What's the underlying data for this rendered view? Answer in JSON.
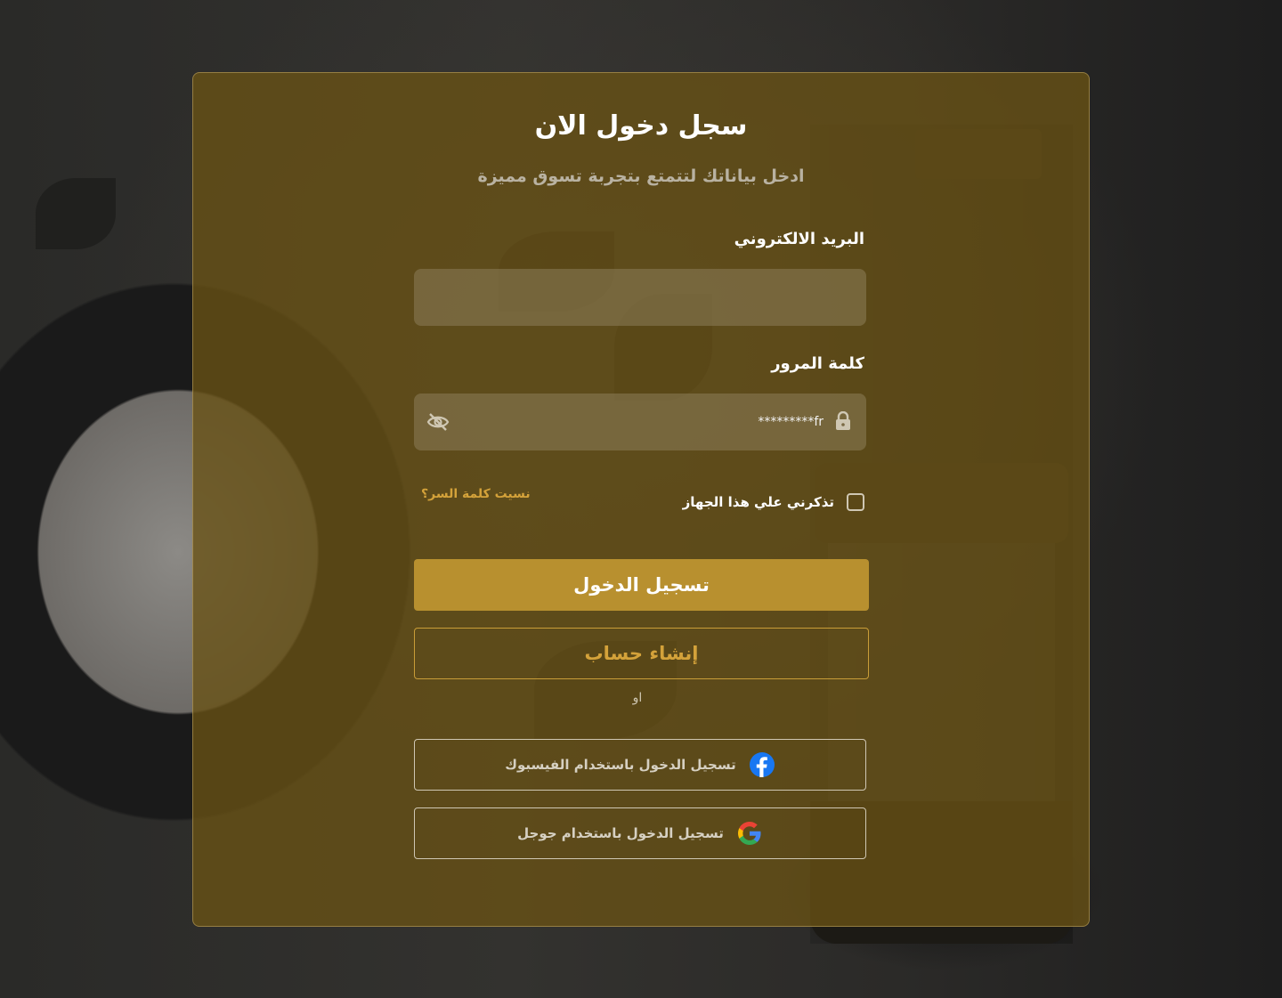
{
  "login": {
    "title": "سجل دخول الان",
    "subtitle": "ادخل بياناتك لتتمتع بتجربة تسوق مميزة",
    "email": {
      "label": "البريد الالكتروني",
      "value": "",
      "placeholder": ""
    },
    "password": {
      "label": "كلمة المرور",
      "value": "fr*********"
    },
    "remember_label": "تذكرني علي هذا الجهاز",
    "forgot_label": "نسيت كلمة السر؟",
    "login_button": "تسجيل الدخول",
    "register_button": "إنشاء حساب",
    "or_label": "او",
    "facebook_label": "تسجيل الدخول باستخدام الفيسبوك",
    "google_label": "تسجيل الدخول باستخدام جوجل"
  },
  "colors": {
    "accent": "#b8902f",
    "accent_text": "#d4a23a",
    "facebook": "#1877f2"
  },
  "icons": [
    "lock-icon",
    "eye-off-icon",
    "facebook-icon",
    "google-icon"
  ]
}
